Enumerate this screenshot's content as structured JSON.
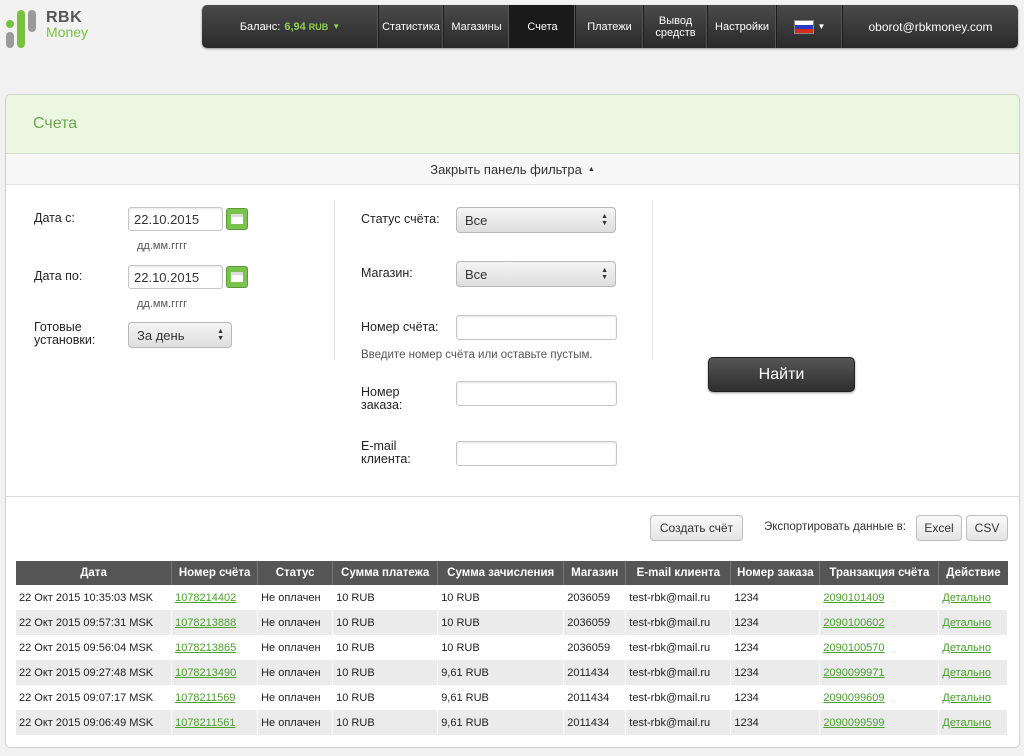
{
  "logo": {
    "line1": "RBK",
    "line2": "Money",
    "color_green": "#79c043",
    "color_grey": "#555555"
  },
  "nav": {
    "balance_label": "Баланс:",
    "balance_value": "6,94",
    "balance_currency": "RUB",
    "items": [
      "Статистика",
      "Магазины",
      "Счета",
      "Платежи",
      "Вывод средств",
      "Настройки"
    ],
    "active": "Счета",
    "language_icon": "russia-flag-icon",
    "email": "oborot@rbkmoney.com"
  },
  "page": {
    "title": "Счета",
    "filter_toggle": "Закрыть панель фильтра",
    "accent": "#6aa84f"
  },
  "filters": {
    "date_from_label": "Дата с:",
    "date_from_value": "22.10.2015",
    "date_from_hint": "дд.мм.гггг",
    "date_to_label": "Дата по:",
    "date_to_value": "22.10.2015",
    "date_to_hint": "дд.мм.гггг",
    "preset_label": "Готовые установки:",
    "preset_value": "За день",
    "status_label": "Статус счёта:",
    "status_value": "Все",
    "shop_label": "Магазин:",
    "shop_value": "Все",
    "invoice_label": "Номер счёта:",
    "invoice_value": "",
    "invoice_hint": "Введите номер счёта или оставьте пустым.",
    "order_label": "Номер заказа:",
    "order_value": "",
    "email_label": "E-mail клиента:",
    "email_value": "",
    "search_button": "Найти"
  },
  "actions": {
    "create_invoice": "Создать счёт",
    "export_label": "Экспортировать данные в:",
    "excel": "Excel",
    "csv": "CSV"
  },
  "table": {
    "columns": [
      "Дата",
      "Номер счёта",
      "Статус",
      "Сумма платежа",
      "Сумма зачисления",
      "Магазин",
      "E-mail клиента",
      "Номер заказа",
      "Транзакция счёта",
      "Действие"
    ],
    "rows": [
      [
        "22 Окт 2015 10:35:03 MSK",
        "1078214402",
        "Не оплачен",
        "10 RUB",
        "10 RUB",
        "2036059",
        "test-rbk@mail.ru",
        "1234",
        "2090101409",
        "Детально"
      ],
      [
        "22 Окт 2015 09:57:31 MSK",
        "1078213888",
        "Не оплачен",
        "10 RUB",
        "10 RUB",
        "2036059",
        "test-rbk@mail.ru",
        "1234",
        "2090100602",
        "Детально"
      ],
      [
        "22 Окт 2015 09:56:04 MSK",
        "1078213865",
        "Не оплачен",
        "10 RUB",
        "10 RUB",
        "2036059",
        "test-rbk@mail.ru",
        "1234",
        "2090100570",
        "Детально"
      ],
      [
        "22 Окт 2015 09:27:48 MSK",
        "1078213490",
        "Не оплачен",
        "10 RUB",
        "9,61 RUB",
        "2011434",
        "test-rbk@mail.ru",
        "1234",
        "2090099971",
        "Детально"
      ],
      [
        "22 Окт 2015 09:07:17 MSK",
        "1078211569",
        "Не оплачен",
        "10 RUB",
        "9,61 RUB",
        "2011434",
        "test-rbk@mail.ru",
        "1234",
        "2090099609",
        "Детально"
      ],
      [
        "22 Окт 2015 09:06:49 MSK",
        "1078211561",
        "Не оплачен",
        "10 RUB",
        "9,61 RUB",
        "2011434",
        "test-rbk@mail.ru",
        "1234",
        "2090099599",
        "Детально"
      ]
    ]
  }
}
